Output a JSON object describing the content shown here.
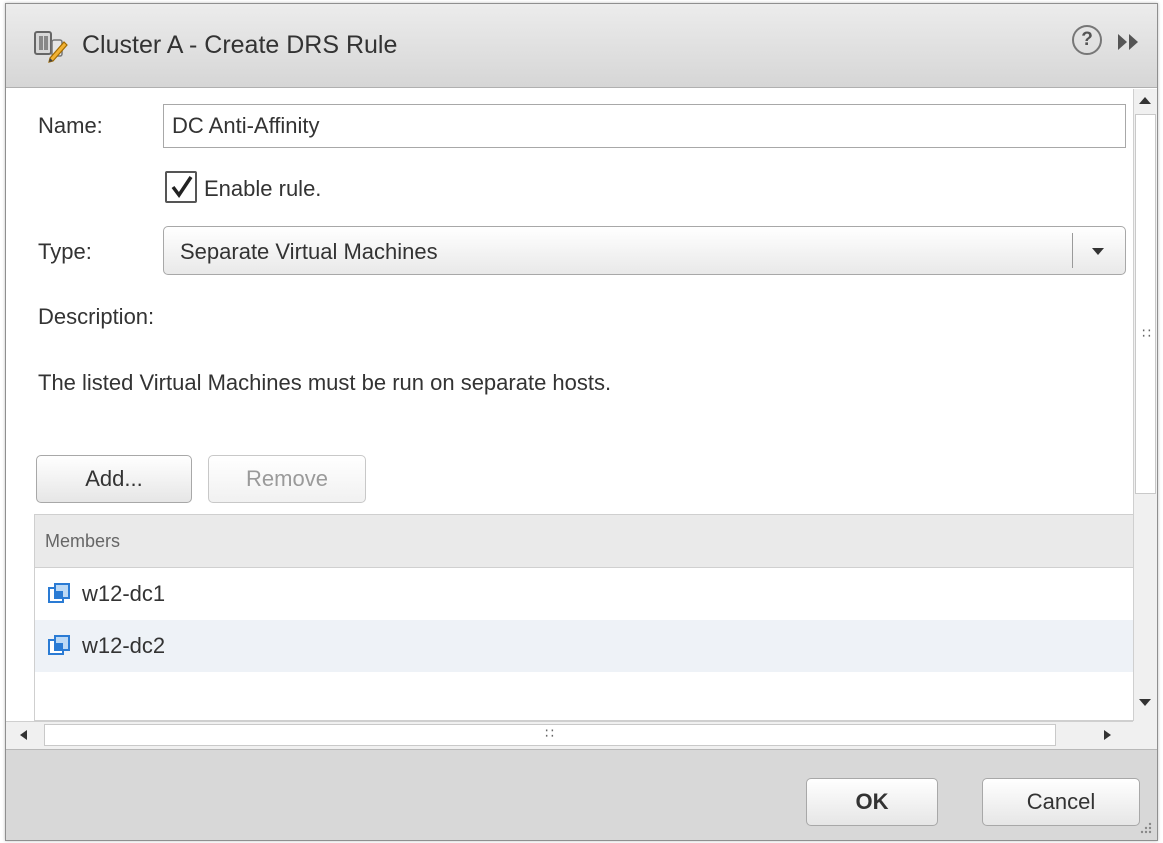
{
  "dialog": {
    "title": "Cluster A - Create DRS Rule",
    "title_icon": "drs-rule-icon",
    "help_symbol": "?"
  },
  "form": {
    "name_label": "Name:",
    "name_value": "DC Anti-Affinity",
    "enable_label": "Enable rule.",
    "enable_checked": true,
    "type_label": "Type:",
    "type_value": "Separate Virtual Machines",
    "description_label": "Description:",
    "description_text": "The listed Virtual Machines must be run on separate hosts."
  },
  "actions": {
    "add_label": "Add...",
    "remove_label": "Remove"
  },
  "members": {
    "header": "Members",
    "items": [
      {
        "name": "w12-dc1",
        "icon": "vm-icon"
      },
      {
        "name": "w12-dc2",
        "icon": "vm-icon"
      }
    ]
  },
  "footer": {
    "ok_label": "OK",
    "cancel_label": "Cancel"
  },
  "colors": {
    "vm_icon": "#2a7bd4",
    "titlebar": "#dcdcdc",
    "footer": "#d8d8d8"
  }
}
